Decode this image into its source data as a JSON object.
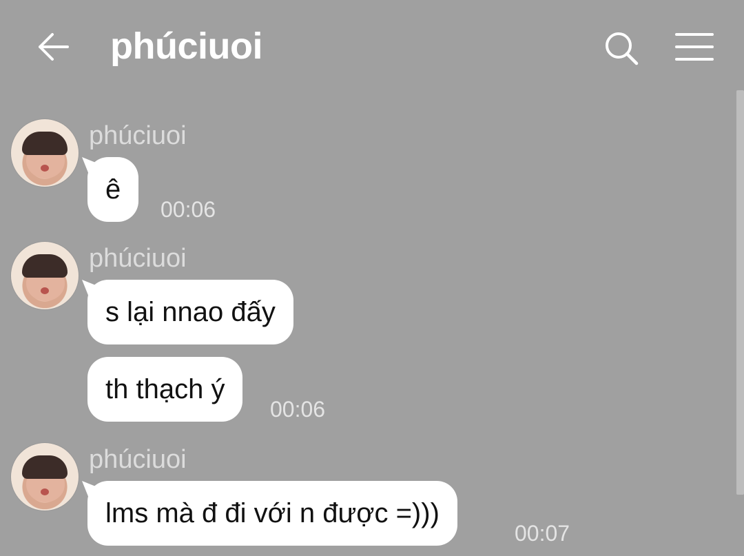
{
  "header": {
    "title": "phúciuoi",
    "back_icon": "arrow-left-icon",
    "search_icon": "search-icon",
    "menu_icon": "menu-icon"
  },
  "messages": [
    {
      "sender": "phúciuoi",
      "bubbles": [
        "ê"
      ],
      "time": "00:06"
    },
    {
      "sender": "phúciuoi",
      "bubbles": [
        "s lại nnao đấy",
        "th thạch ý"
      ],
      "time": "00:06"
    },
    {
      "sender": "phúciuoi",
      "bubbles": [
        "lms mà đ đi với n được  =)))"
      ],
      "time": "00:07"
    }
  ],
  "colors": {
    "background": "#a0a0a0",
    "bubble": "#ffffff",
    "header_text": "#ffffff",
    "sender_text": "#dcdcdc"
  }
}
